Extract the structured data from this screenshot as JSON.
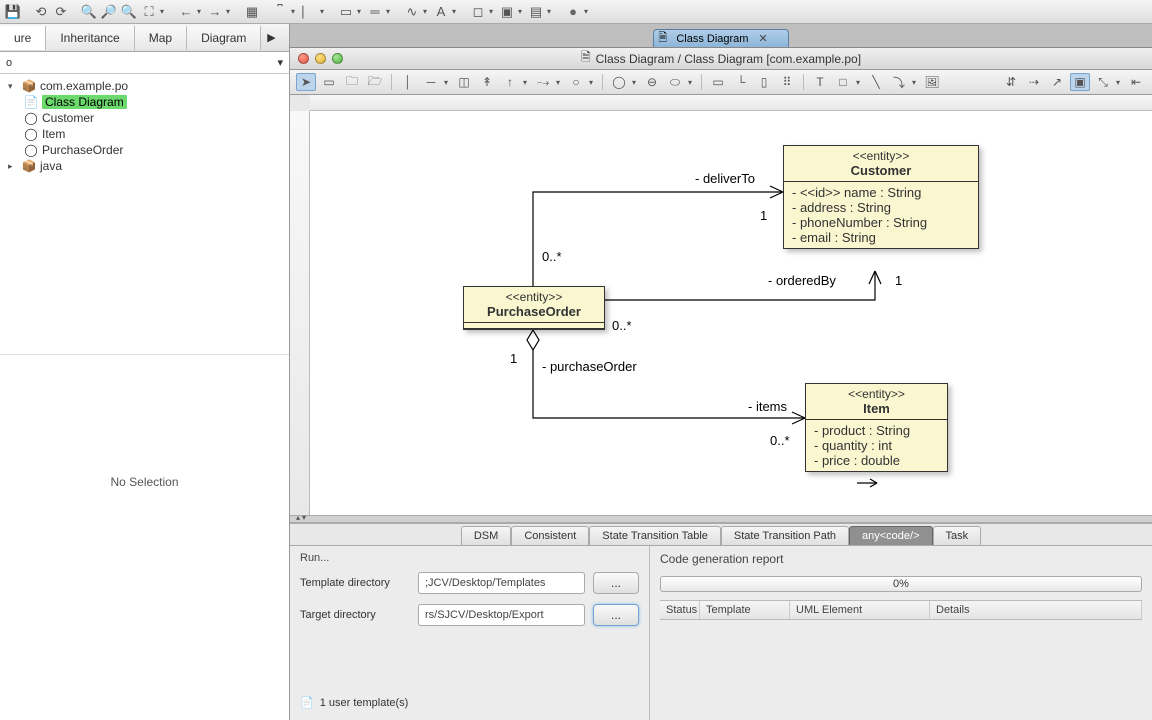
{
  "nav_tabs": {
    "t0": "ure",
    "t1": "Inheritance",
    "t2": "Map",
    "t3": "Diagram"
  },
  "breadcrumb": "o",
  "tree": {
    "pkg": "com.example.po",
    "diagram": "Class Diagram",
    "c0": "Customer",
    "c1": "Item",
    "c2": "PurchaseOrder",
    "java": "java"
  },
  "no_selection": "No Selection",
  "file_tab": {
    "label": "Class Diagram"
  },
  "window_title": "Class Diagram / Class Diagram [com.example.po]",
  "entities": {
    "customer": {
      "stereotype": "<<entity>>",
      "name": "Customer",
      "attrs": {
        "a0": "- <<id>> name : String",
        "a1": "- address : String",
        "a2": "- phoneNumber : String",
        "a3": "- email : String"
      }
    },
    "po": {
      "stereotype": "<<entity>>",
      "name": "PurchaseOrder"
    },
    "item": {
      "stereotype": "<<entity>>",
      "name": "Item",
      "attrs": {
        "a0": "- product : String",
        "a1": "- quantity : int",
        "a2": "- price : double"
      }
    }
  },
  "assoc": {
    "deliverTo": "- deliverTo",
    "deliverTo_m1": "1",
    "deliverTo_m2": "0..*",
    "orderedBy": "- orderedBy",
    "orderedBy_m1": "1",
    "orderedBy_m2": "0..*",
    "purchaseOrder": "- purchaseOrder",
    "po_m1": "1",
    "items": "- items",
    "items_m2": "0..*"
  },
  "bottom_tabs": {
    "t0": "DSM",
    "t1": "Consistent",
    "t2": "State Transition Table",
    "t3": "State Transition Path",
    "t4": "any<code/>",
    "t5": "Task"
  },
  "run": {
    "title": "Run...",
    "tmpl_label": "Template directory",
    "tmpl_val": ";JCV/Desktop/Templates",
    "tgt_label": "Target directory",
    "tgt_val": "rs/SJCV/Desktop/Export",
    "browse": "...",
    "templates": "1 user template(s)"
  },
  "report": {
    "title": "Code generation report",
    "progress": "0%",
    "h0": "Status",
    "h1": "Template",
    "h2": "UML Element",
    "h3": "Details"
  }
}
